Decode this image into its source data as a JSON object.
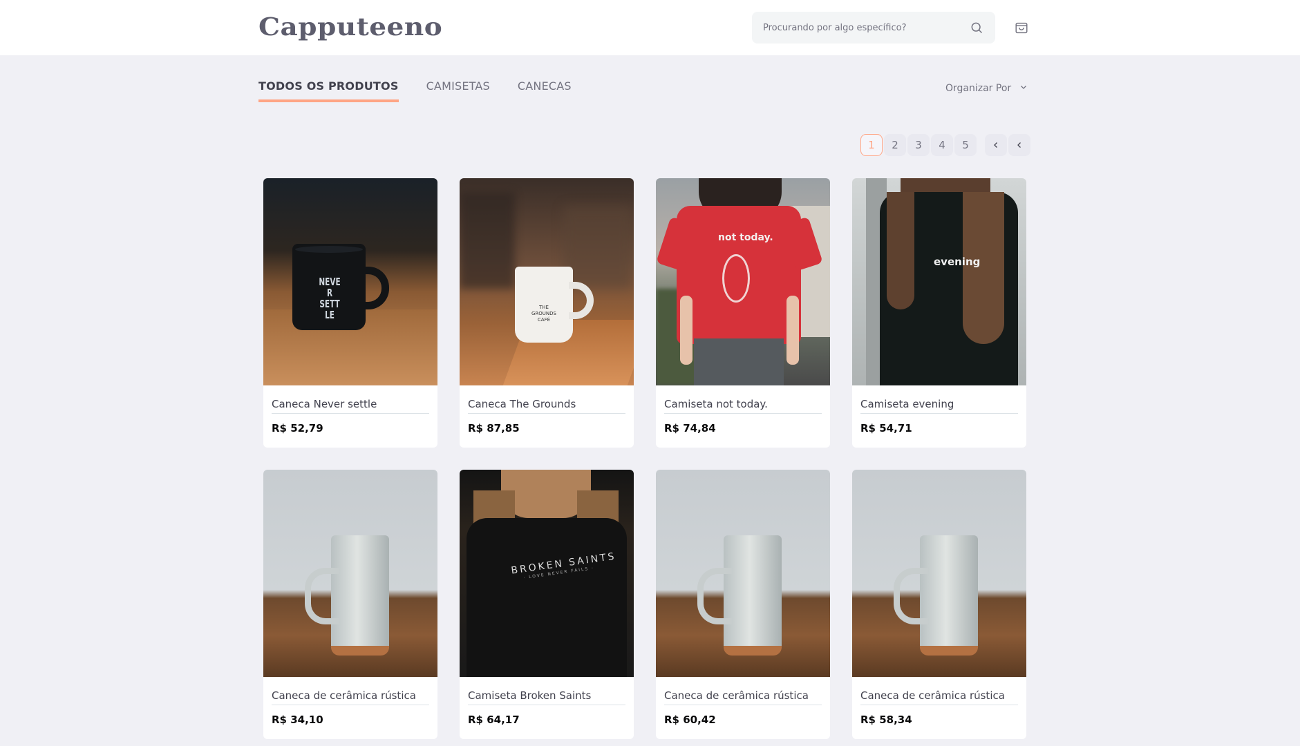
{
  "brand": {
    "name": "Capputeeno"
  },
  "search": {
    "placeholder": "Procurando por algo específico?"
  },
  "tabs": [
    {
      "label": "TODOS OS PRODUTOS",
      "active": true
    },
    {
      "label": "CAMISETAS",
      "active": false
    },
    {
      "label": "CANECAS",
      "active": false
    }
  ],
  "sort": {
    "label": "Organizar Por"
  },
  "pagination": {
    "pages": [
      "1",
      "2",
      "3",
      "4",
      "5"
    ],
    "current": "1"
  },
  "products": [
    {
      "name": "Caneca Never settle",
      "price": "R$ 52,79",
      "image": "mug-never-settle"
    },
    {
      "name": "Caneca The Grounds",
      "price": "R$ 87,85",
      "image": "mug-the-grounds"
    },
    {
      "name": "Camiseta not today.",
      "price": "R$ 74,84",
      "image": "tshirt-not-today"
    },
    {
      "name": "Camiseta evening",
      "price": "R$ 54,71",
      "image": "tshirt-evening"
    },
    {
      "name": "Caneca de cerâmica rústica",
      "price": "R$ 34,10",
      "image": "ceramic-mug"
    },
    {
      "name": "Camiseta Broken Saints",
      "price": "R$ 64,17",
      "image": "tshirt-broken-saints"
    },
    {
      "name": "Caneca de cerâmica rústica",
      "price": "R$ 60,42",
      "image": "ceramic-mug"
    },
    {
      "name": "Caneca de cerâmica rústica",
      "price": "R$ 58,34",
      "image": "ceramic-mug"
    }
  ],
  "image_text": {
    "never_settle": "NEVER SETTLE",
    "grounds": "THE GROUNDS CAFÉ",
    "not_today": "not today.",
    "evening": "evening",
    "broken_saints": "BROKEN SAINTS",
    "broken_saints_sub": "· LOVE NEVER FAILS ·"
  },
  "colors": {
    "accent": "#ffa585",
    "background": "#f0f0f5",
    "text": "#41414d"
  },
  "icons": {
    "search": "search-icon",
    "cart": "shopping-bag-icon",
    "sort": "chevron-down-icon",
    "prev": "chevron-left-icon",
    "next": "chevron-left-icon"
  }
}
